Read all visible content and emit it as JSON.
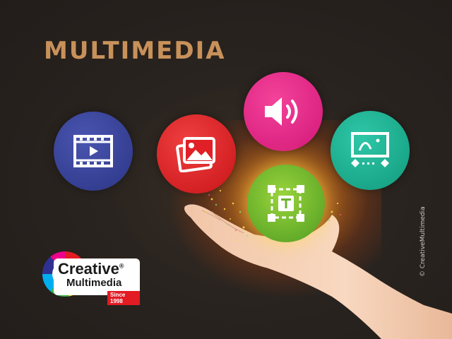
{
  "title": "MULTIMEDIA",
  "icons": {
    "video": "video-icon",
    "image": "image-icon",
    "audio": "audio-icon",
    "animation": "animation-icon",
    "text": "text-icon"
  },
  "colors": {
    "title": "#c8915a",
    "video": "#3a4499",
    "image": "#e02026",
    "audio": "#e62588",
    "animation": "#1fb090",
    "text": "#6cb32e",
    "background": "#2a2420"
  },
  "logo": {
    "line1": "Creative",
    "registered": "®",
    "line2": "Multimedia",
    "since": "Since 1998"
  },
  "copyright": "© CreativeMultimedia"
}
